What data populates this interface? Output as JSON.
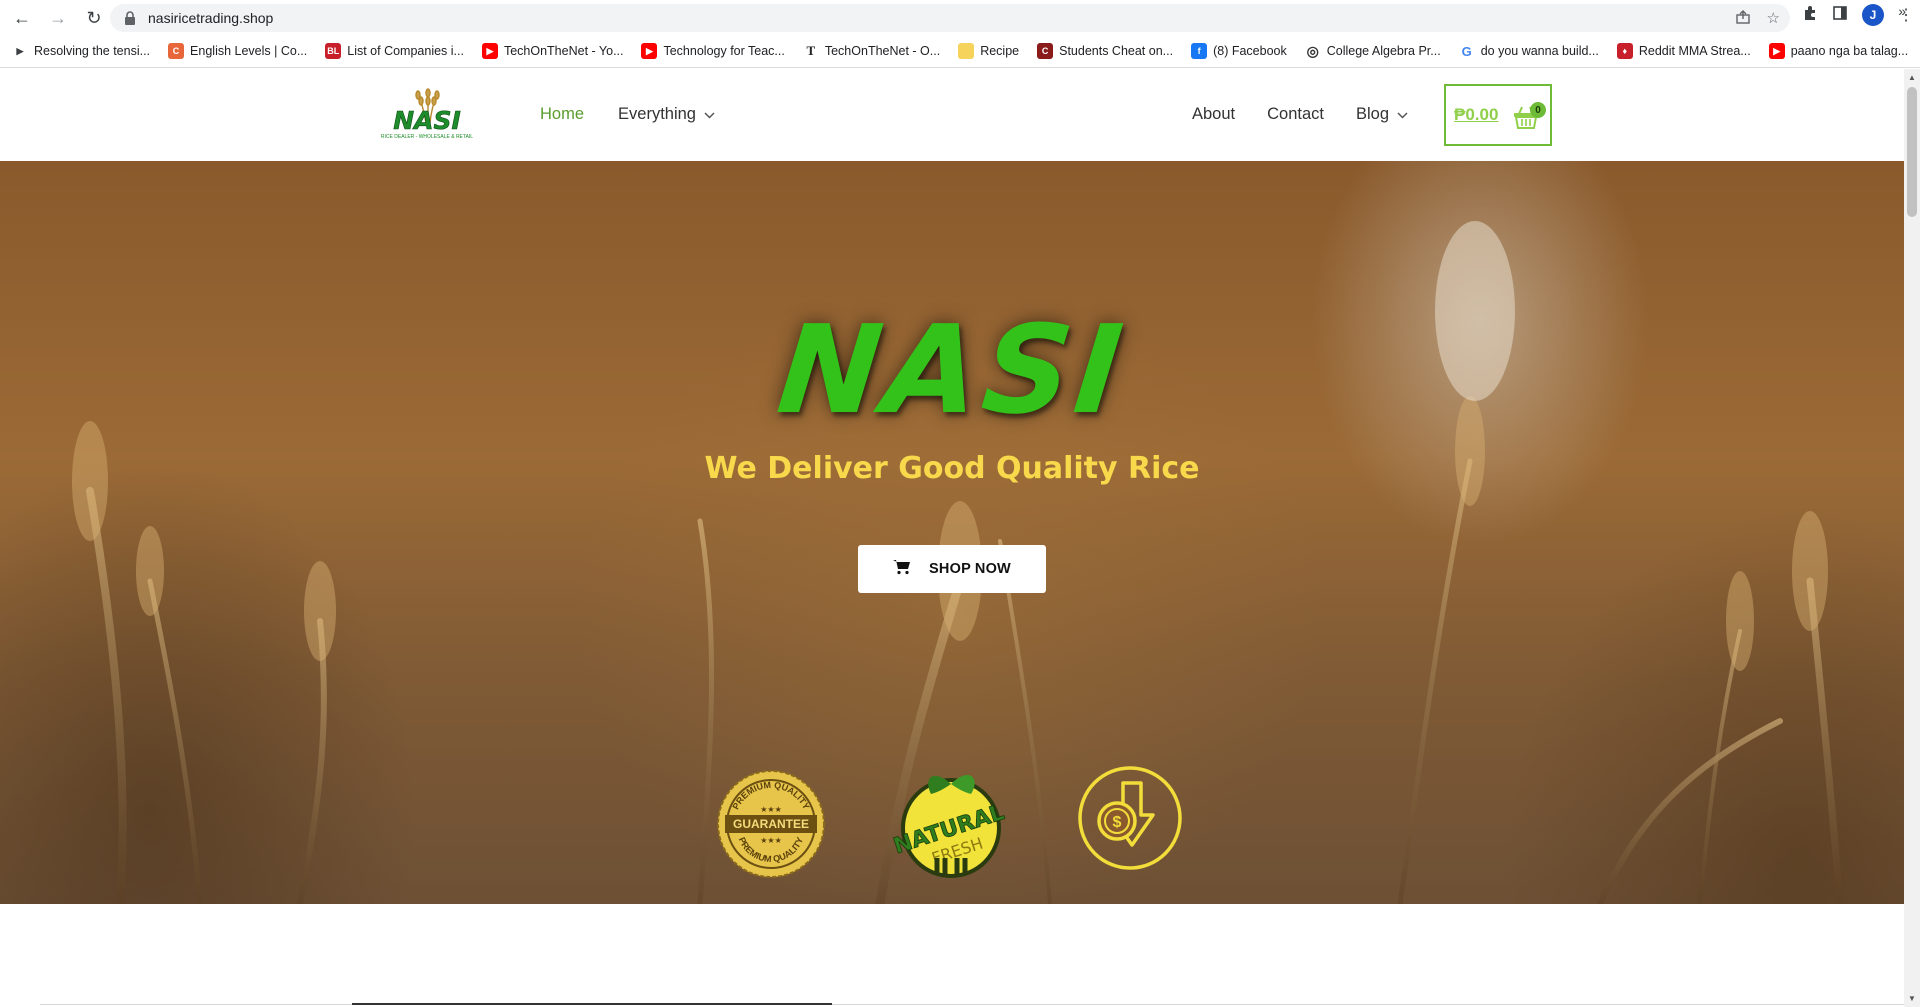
{
  "browser": {
    "url": "nasiricetrading.shop",
    "profile_initial": "J",
    "bookmarks": [
      {
        "label": "Resolving the tensi...",
        "icon": "document-icon",
        "color": "#3c4043"
      },
      {
        "label": "English Levels | Co...",
        "icon": "site-icon",
        "color": "#e8673a"
      },
      {
        "label": "List of Companies i...",
        "icon": "bl-icon",
        "color": "#c8202b"
      },
      {
        "label": "TechOnTheNet - Yo...",
        "icon": "youtube-icon",
        "color": "#ff0000"
      },
      {
        "label": "Technology for Teac...",
        "icon": "youtube-icon",
        "color": "#ff0000"
      },
      {
        "label": "TechOnTheNet - O...",
        "icon": "t-icon",
        "color": "#222222"
      },
      {
        "label": "Recipe",
        "icon": "folder-icon",
        "color": "#f6d35a"
      },
      {
        "label": "Students Cheat on...",
        "icon": "c-icon",
        "color": "#8b1a1a"
      },
      {
        "label": "(8) Facebook",
        "icon": "facebook-icon",
        "color": "#1877f2"
      },
      {
        "label": "College Algebra Pr...",
        "icon": "globe-icon",
        "color": "#333333"
      },
      {
        "label": "do you wanna build...",
        "icon": "google-icon",
        "color": "#4285f4"
      },
      {
        "label": "Reddit MMA Strea...",
        "icon": "reddit-icon",
        "color": "#c8202b"
      },
      {
        "label": "paano nga ba talag...",
        "icon": "youtube-icon",
        "color": "#ff0000"
      }
    ]
  },
  "header": {
    "menu_left": [
      {
        "label": "Home",
        "active": true,
        "dropdown": false
      },
      {
        "label": "Everything",
        "active": false,
        "dropdown": true
      }
    ],
    "menu_right": [
      {
        "label": "About",
        "dropdown": false
      },
      {
        "label": "Contact",
        "dropdown": false
      },
      {
        "label": "Blog",
        "dropdown": true
      }
    ],
    "cart_amount": "₱0.00",
    "cart_count": "0"
  },
  "hero": {
    "title": "NASI",
    "subtitle": "We Deliver Good Quality Rice",
    "shop_button": "SHOP NOW",
    "badges": [
      {
        "name": "premium-quality-guarantee-badge",
        "top": "PREMIUM QUALITY",
        "middle": "GUARANTEE",
        "bottom": "PREMIUM QUALITY"
      },
      {
        "name": "natural-fresh-badge",
        "top": "NATURAL",
        "bottom": "FRESH"
      },
      {
        "name": "low-price-badge"
      }
    ]
  },
  "logo": {
    "text": "NASI",
    "tagline": "RICE DEALER - WHOLESALE & RETAIL"
  },
  "colors": {
    "accent_green": "#32c21a",
    "nav_active": "#5a9d2d",
    "subtitle_yellow": "#f7d94b",
    "cart_border": "#6dbb36"
  }
}
